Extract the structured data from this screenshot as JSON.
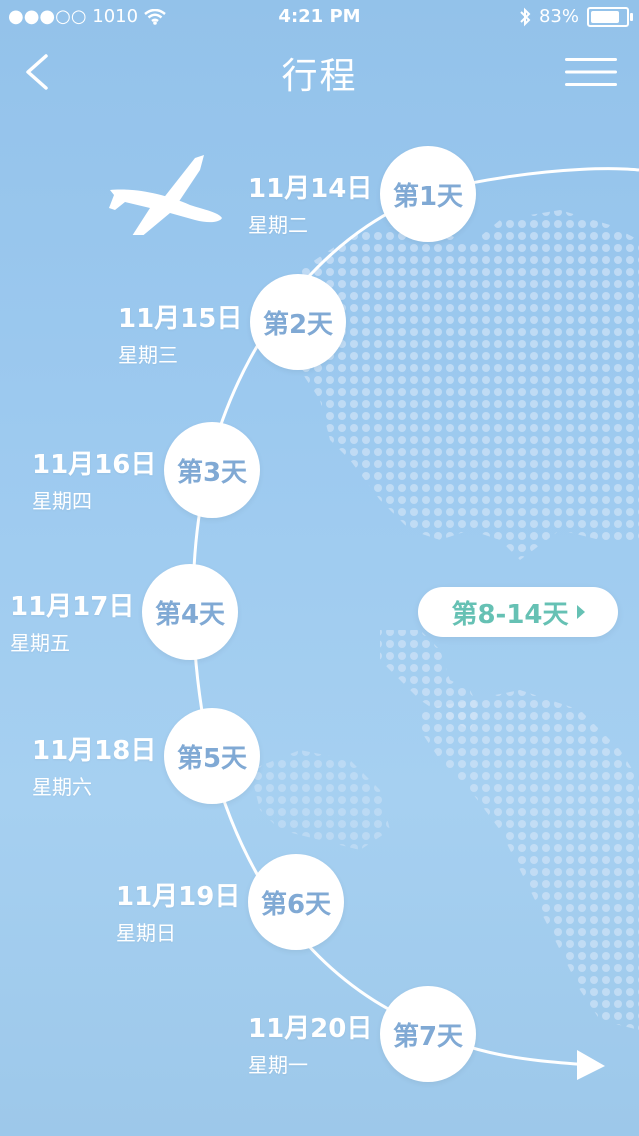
{
  "status": {
    "carrier": "●●●○○ 1010",
    "time": "4:21 PM",
    "battery": "83%",
    "battery_level": 0.83
  },
  "nav": {
    "title": "行程"
  },
  "itinerary": [
    {
      "date": "11月14日",
      "weekday": "星期二",
      "day": "第1天"
    },
    {
      "date": "11月15日",
      "weekday": "星期三",
      "day": "第2天"
    },
    {
      "date": "11月16日",
      "weekday": "星期四",
      "day": "第3天"
    },
    {
      "date": "11月17日",
      "weekday": "星期五",
      "day": "第4天"
    },
    {
      "date": "11月18日",
      "weekday": "星期六",
      "day": "第5天"
    },
    {
      "date": "11月19日",
      "weekday": "星期日",
      "day": "第6天"
    },
    {
      "date": "11月20日",
      "weekday": "星期一",
      "day": "第7天"
    }
  ],
  "range_button": {
    "label": "第8-14天"
  },
  "icons": {
    "back": "chevron-left-icon",
    "menu": "hamburger-icon",
    "plane": "airplane-icon"
  },
  "colors": {
    "accent": "#66c1b4",
    "circle_text": "#80a9d4",
    "sky": "#9cc9ef"
  }
}
